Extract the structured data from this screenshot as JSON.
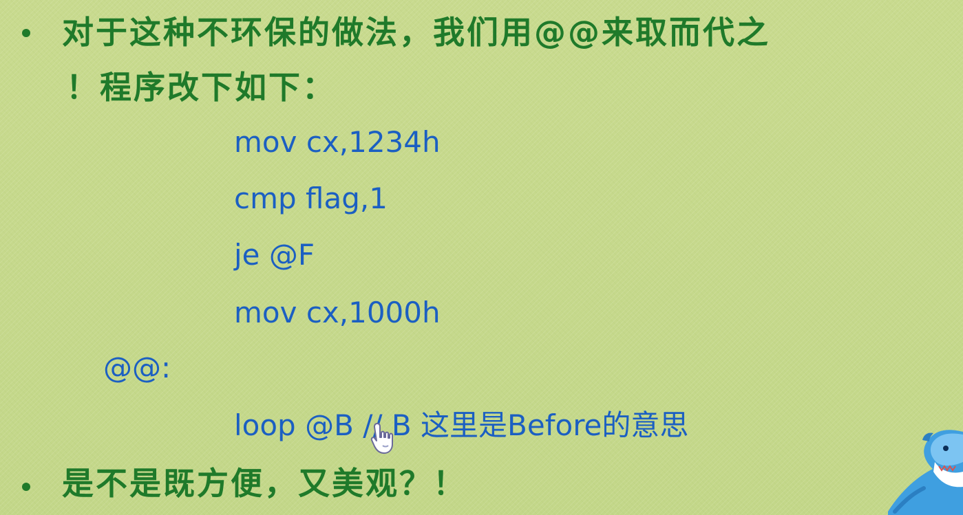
{
  "slide": {
    "bullet1_line1": "对于这种不环保的做法，我们用@@来取而代之",
    "bullet1_line2": "！程序改下如下：",
    "code": {
      "line1": "mov cx,1234h",
      "line2": "cmp flag,1",
      "line3": "je @F",
      "line4": "mov cx,1000h",
      "label": "@@:",
      "line5": "loop @B  // B 这里是Before的意思"
    },
    "bullet2": "是不是既方便，又美观？！"
  },
  "colors": {
    "background": "#c6d98c",
    "bullet_text": "#1f7a2a",
    "code_text": "#1b5fc2"
  },
  "icons": {
    "cursor": "hand-pointer-icon",
    "mascot": "shark-mascot-icon"
  }
}
